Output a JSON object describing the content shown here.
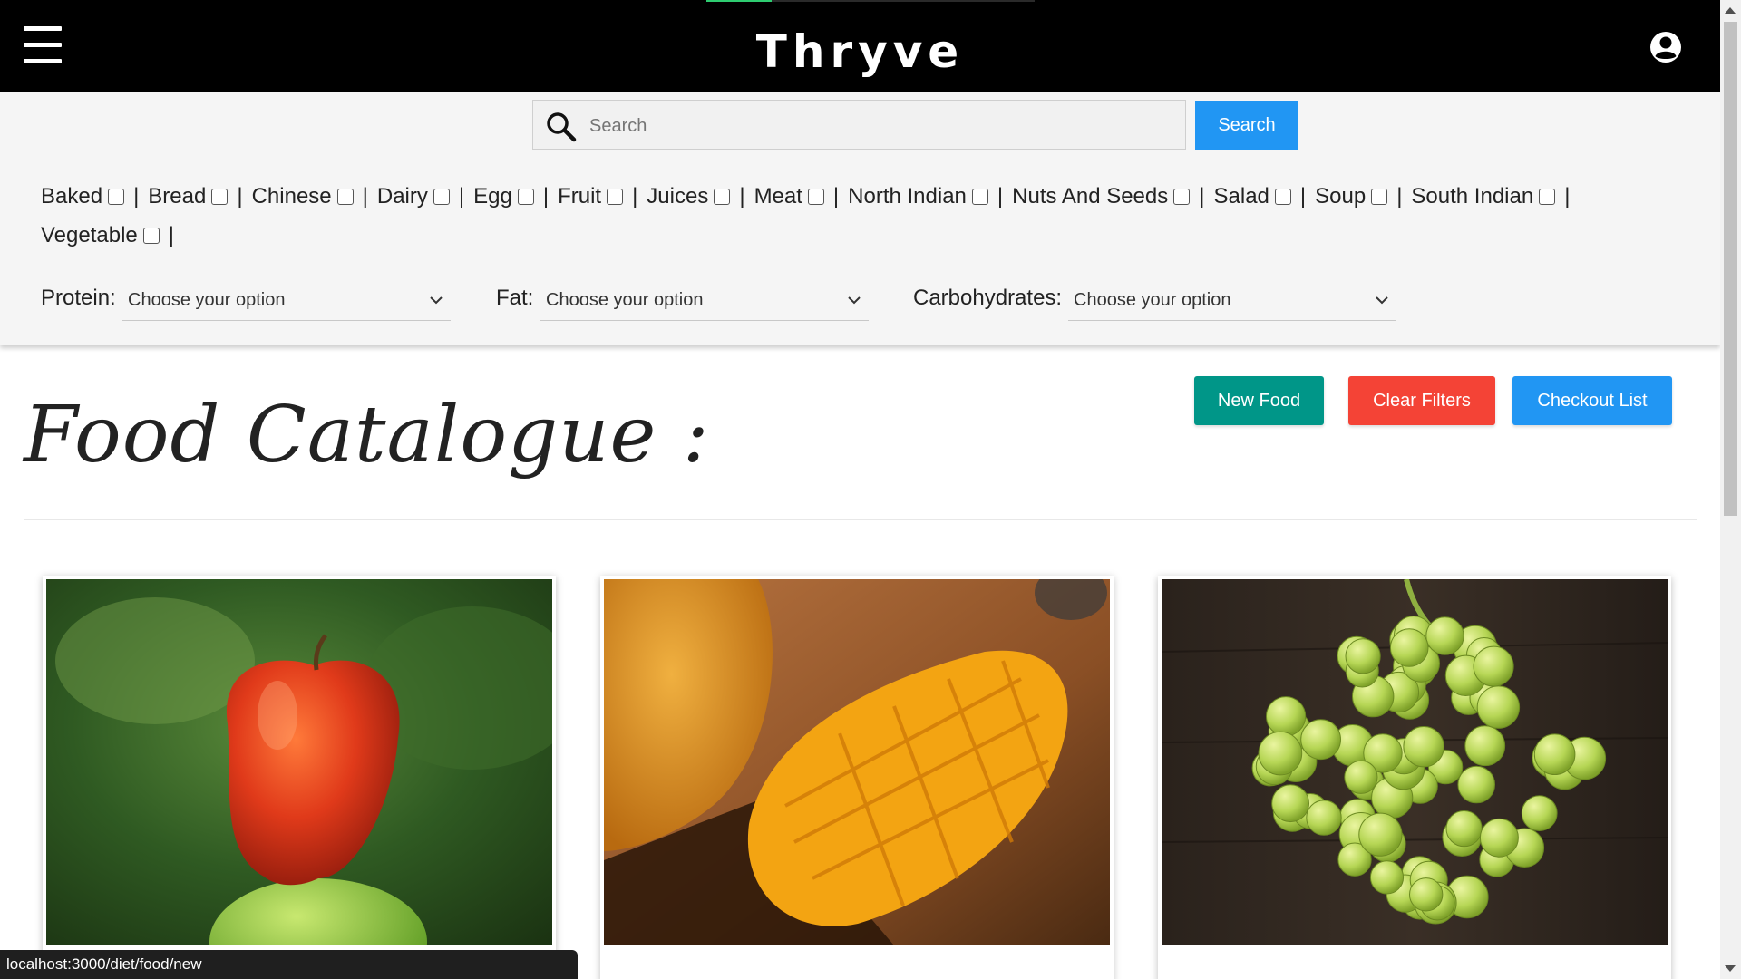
{
  "navbar": {
    "brand": "Thryve",
    "page_load_progress": 0.2,
    "colors": {
      "background": "#000000",
      "text": "#ffffff",
      "progress": "#2ecc71"
    }
  },
  "search": {
    "placeholder": "Search",
    "value": "",
    "button_label": "Search"
  },
  "categories": [
    {
      "label": "Baked",
      "checked": false
    },
    {
      "label": "Bread",
      "checked": false
    },
    {
      "label": "Chinese",
      "checked": false
    },
    {
      "label": "Dairy",
      "checked": false
    },
    {
      "label": "Egg",
      "checked": false
    },
    {
      "label": "Fruit",
      "checked": false
    },
    {
      "label": "Juices",
      "checked": false
    },
    {
      "label": "Meat",
      "checked": false
    },
    {
      "label": "North Indian",
      "checked": false
    },
    {
      "label": "Nuts And Seeds",
      "checked": false
    },
    {
      "label": "Salad",
      "checked": false
    },
    {
      "label": "Soup",
      "checked": false
    },
    {
      "label": "South Indian",
      "checked": false
    },
    {
      "label": "Vegetable",
      "checked": false
    }
  ],
  "category_separator": "|",
  "nutrient_filters": [
    {
      "label": "Protein:",
      "value": "Choose your option"
    },
    {
      "label": "Fat:",
      "value": "Choose your option"
    },
    {
      "label": "Carbohydrates:",
      "value": "Choose your option"
    }
  ],
  "actions": {
    "new_food": "New Food",
    "clear_filters": "Clear Filters",
    "checkout_list": "Checkout List",
    "colors": {
      "new_food": "#009688",
      "clear_filters": "#f44336",
      "checkout_list": "#2196f3"
    }
  },
  "page_title": "Food Catalogue :",
  "foods": [
    {
      "name": "",
      "image": "apple-photo"
    },
    {
      "name": "",
      "image": "mango-photo"
    },
    {
      "name": "",
      "image": "grapes-photo"
    }
  ],
  "status_bar": "localhost:3000/diet/food/new",
  "icons": {
    "menu": "hamburger-menu-icon",
    "user": "user-account-icon",
    "search": "magnifier-icon",
    "select": "chevron-down-icon"
  }
}
